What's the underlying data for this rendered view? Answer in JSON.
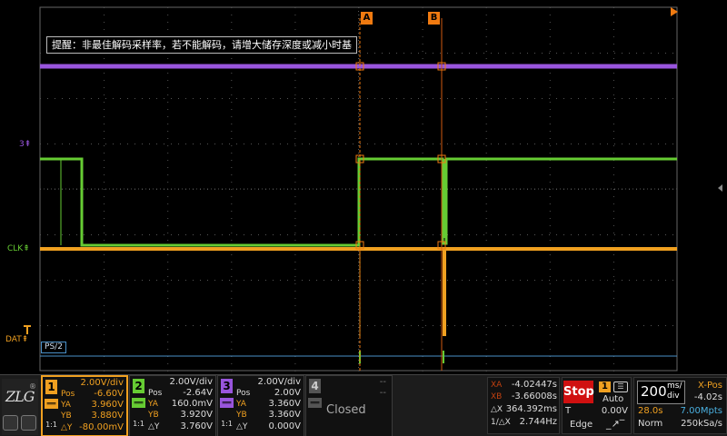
{
  "hint": "提醒：非最佳解码采样率，若不能解码，请增大储存深度或减小时基",
  "cursors": {
    "a_label": "A",
    "b_label": "B"
  },
  "channel_labels": {
    "ch3": "3",
    "clk": "CLK",
    "dat": "DAT"
  },
  "bus": {
    "label": "PS/2"
  },
  "colors": {
    "ch1": "#f0a020",
    "ch2": "#66cc33",
    "ch3": "#9955dd",
    "cursor": "#f07a10",
    "bus": "#4a90c8"
  },
  "channels": [
    {
      "num": "1",
      "scale": "2.00V/div",
      "pos_label": "Pos",
      "pos": "-6.60V",
      "ya_label": "YA",
      "ya": "3.960V",
      "yb_label": "YB",
      "yb": "3.880V",
      "dy_label": "△Y",
      "dy": "-80.00mV",
      "coupling": "1:1"
    },
    {
      "num": "2",
      "scale": "2.00V/div",
      "pos_label": "Pos",
      "pos": "-2.64V",
      "ya_label": "YA",
      "ya": "160.0mV",
      "yb_label": "YB",
      "yb": "3.920V",
      "dy_label": "△Y",
      "dy": "3.760V",
      "coupling": "1:1"
    },
    {
      "num": "3",
      "scale": "2.00V/div",
      "pos_label": "Pos",
      "pos": "2.00V",
      "ya_label": "YA",
      "ya": "3.360V",
      "yb_label": "YB",
      "yb": "3.360V",
      "dy_label": "△Y",
      "dy": "0.000V",
      "coupling": "1:1"
    },
    {
      "num": "4",
      "scale": "--",
      "pos": "--",
      "status": "Closed"
    }
  ],
  "measure": {
    "xa_label": "XA",
    "xa": "-4.02447s",
    "xb_label": "XB",
    "xb": "-3.66008s",
    "dx_label": "△X",
    "dx": "364.392ms",
    "freq_label": "1/△X",
    "freq": "2.744Hz"
  },
  "trigger": {
    "status": "Stop",
    "source": "1",
    "mode": "Auto",
    "type_label": "T",
    "level": "0.00V",
    "slope_label": "Edge"
  },
  "timebase": {
    "value": "200",
    "unit_top": "ms/",
    "unit_bottom": "div",
    "xpos_label": "X-Pos",
    "xpos": "-4.02s",
    "time": "28.0s",
    "depth": "7.00Mpts",
    "mode": "Norm",
    "rate": "250kSa/s"
  }
}
